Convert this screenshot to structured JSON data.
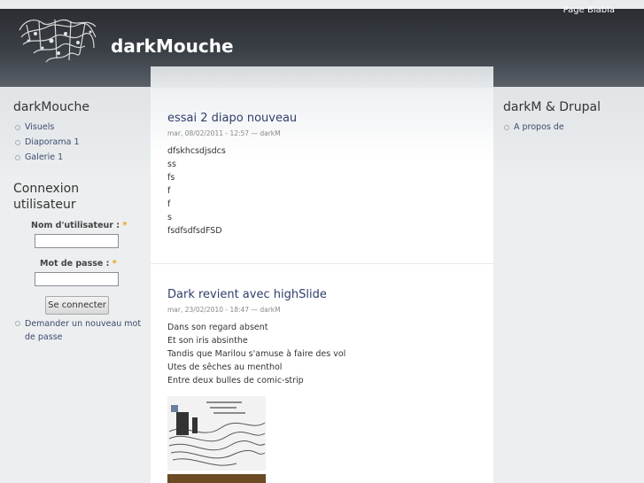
{
  "site": {
    "name": "darkMouche"
  },
  "primary_links": [
    {
      "label": "Page Blabla"
    }
  ],
  "sidebar_left": {
    "nav_block": {
      "title": "darkMouche",
      "items": [
        {
          "label": "Visuels"
        },
        {
          "label": "Diaporama 1"
        },
        {
          "label": "Galerie 1"
        }
      ]
    },
    "login_block": {
      "title": "Connexion utilisateur",
      "username_label": "Nom d'utilisateur :",
      "password_label": "Mot de passe :",
      "required_marker": "*",
      "submit_label": "Se connecter",
      "new_password_link": "Demander un nouveau mot de passe"
    }
  },
  "sidebar_right": {
    "block": {
      "title": "darkM & Drupal",
      "items": [
        {
          "label": "A propos de"
        }
      ]
    }
  },
  "nodes": [
    {
      "title": "essai 2 diapo nouveau",
      "meta": "mar, 08/02/2011 - 12:57 — darkM",
      "body": [
        "dfskhcsdjsdcs",
        "ss",
        "fs",
        "f",
        "f",
        "s",
        "fsdfsdfsdFSD"
      ]
    },
    {
      "title": "Dark revient avec highSlide",
      "meta": "mar, 23/02/2010 - 18:47 — darkM",
      "body": [
        "Dans son regard absent",
        "Et son iris absinthe",
        "Tandis que Marilou s'amuse à faire des vol",
        "Utes de sêches au menthol",
        "Entre deux bulles de comic-strip"
      ]
    }
  ],
  "colors": {
    "header_dark": "#2a2d31",
    "link": "#2f3f6b",
    "required": "#e8a012"
  }
}
